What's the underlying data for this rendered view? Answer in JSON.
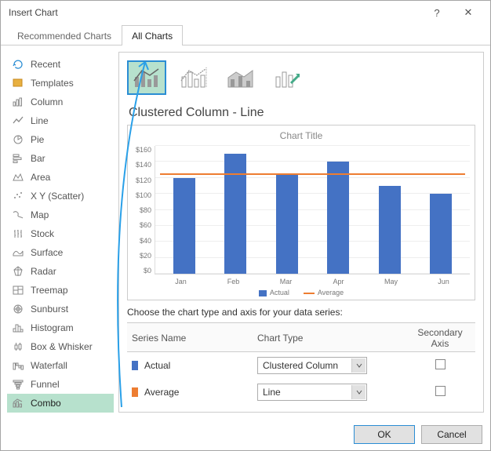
{
  "window": {
    "title": "Insert Chart"
  },
  "tabs": [
    {
      "label": "Recommended Charts",
      "active": false
    },
    {
      "label": "All Charts",
      "active": true
    }
  ],
  "sidebar": {
    "items": [
      {
        "label": "Recent"
      },
      {
        "label": "Templates"
      },
      {
        "label": "Column"
      },
      {
        "label": "Line"
      },
      {
        "label": "Pie"
      },
      {
        "label": "Bar"
      },
      {
        "label": "Area"
      },
      {
        "label": "X Y (Scatter)"
      },
      {
        "label": "Map"
      },
      {
        "label": "Stock"
      },
      {
        "label": "Surface"
      },
      {
        "label": "Radar"
      },
      {
        "label": "Treemap"
      },
      {
        "label": "Sunburst"
      },
      {
        "label": "Histogram"
      },
      {
        "label": "Box & Whisker"
      },
      {
        "label": "Waterfall"
      },
      {
        "label": "Funnel"
      },
      {
        "label": "Combo",
        "selected": true
      }
    ]
  },
  "main": {
    "chart_name": "Clustered Column - Line",
    "preview_title": "Chart Title",
    "series_instruction": "Choose the chart type and axis for your data series:",
    "headers": {
      "name": "Series Name",
      "type": "Chart Type",
      "axis": "Secondary Axis"
    },
    "series": [
      {
        "name": "Actual",
        "color": "#4472c4",
        "chart_type": "Clustered Column",
        "secondary": false
      },
      {
        "name": "Average",
        "color": "#ed7d31",
        "chart_type": "Line",
        "secondary": false
      }
    ],
    "legend": {
      "s1": "Actual",
      "s2": "Average"
    }
  },
  "footer": {
    "ok": "OK",
    "cancel": "Cancel"
  },
  "chart_data": {
    "type": "combo",
    "title": "Chart Title",
    "categories": [
      "Jan",
      "Feb",
      "Mar",
      "Apr",
      "May",
      "Jun"
    ],
    "ylabel": "",
    "ylim": [
      0,
      160
    ],
    "yticks": [
      0,
      20,
      40,
      60,
      80,
      100,
      120,
      140,
      160
    ],
    "series": [
      {
        "name": "Actual",
        "type": "bar",
        "color": "#4472c4",
        "values": [
          120,
          150,
          125,
          140,
          110,
          100
        ]
      },
      {
        "name": "Average",
        "type": "line",
        "color": "#ed7d31",
        "values": [
          124,
          124,
          124,
          124,
          124,
          124
        ]
      }
    ]
  }
}
